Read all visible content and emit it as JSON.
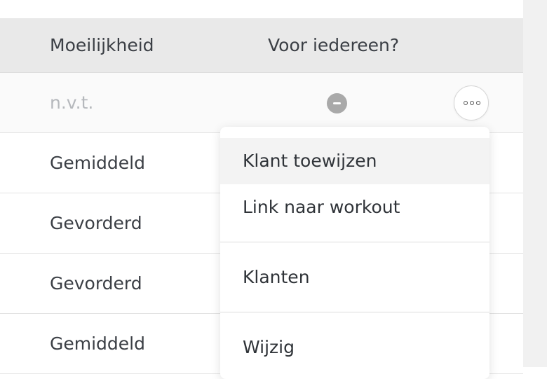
{
  "table": {
    "columns": {
      "difficulty": "Moeilijkheid",
      "for_everyone": "Voor iedereen?"
    },
    "rows": [
      {
        "difficulty": "n.v.t.",
        "for_everyone_icon": "minus-circle-icon"
      },
      {
        "difficulty": "Gemiddeld"
      },
      {
        "difficulty": "Gevorderd"
      },
      {
        "difficulty": "Gevorderd"
      },
      {
        "difficulty": "Gemiddeld"
      }
    ]
  },
  "more_button": {
    "icon": "more-dots-icon"
  },
  "menu": {
    "items": [
      {
        "label": "Klant toewijzen"
      },
      {
        "label": "Link naar workout"
      },
      {
        "label": "Klanten"
      },
      {
        "label": "Wijzig"
      }
    ]
  }
}
